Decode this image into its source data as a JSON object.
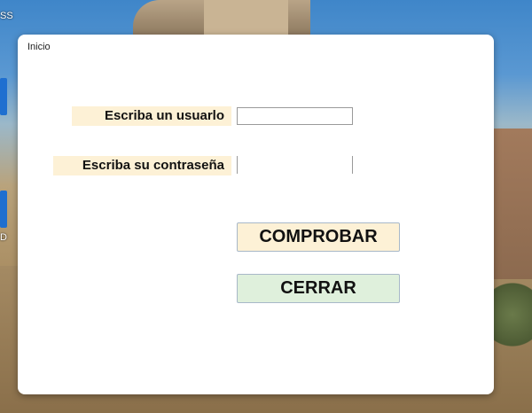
{
  "window": {
    "title": "Inicio"
  },
  "form": {
    "user_label": "Escriba un usuarlo",
    "user_value": "",
    "password_label": "Escriba su contraseña",
    "password_value": ""
  },
  "buttons": {
    "check_label": "COMPROBAR",
    "close_label": "CERRAR"
  },
  "desktop": {
    "icon_label_top": "SS",
    "icon_label_bottom": "D"
  },
  "colors": {
    "label_bg": "#fdf1d6",
    "check_bg": "#fdf1d6",
    "close_bg": "#dff0dc"
  }
}
